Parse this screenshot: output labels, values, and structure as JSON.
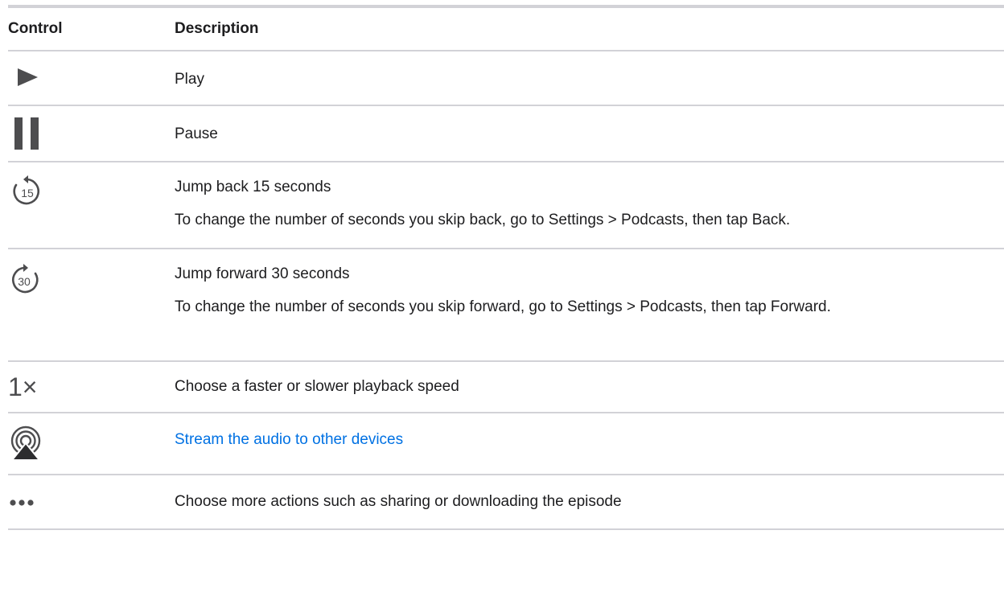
{
  "table": {
    "header": {
      "control": "Control",
      "description": "Description"
    },
    "rows": [
      {
        "icon": "play-icon",
        "lines": [
          "Play"
        ]
      },
      {
        "icon": "pause-icon",
        "lines": [
          "Pause"
        ]
      },
      {
        "icon": "skip-back-15-icon",
        "glyph": "15",
        "lines": [
          "Jump back 15 seconds",
          "To change the number of seconds you skip back, go to Settings > Podcasts, then tap Back."
        ]
      },
      {
        "icon": "skip-forward-30-icon",
        "glyph": "30",
        "lines": [
          "Jump forward 30 seconds",
          "To change the number of seconds you skip forward, go to Settings > Podcasts, then tap Forward."
        ]
      },
      {
        "icon": "playback-speed-icon",
        "glyph": "1×",
        "lines": [
          "Choose a faster or slower playback speed"
        ]
      },
      {
        "icon": "airplay-icon",
        "lines": [
          "Stream the audio to other devices"
        ],
        "link": true
      },
      {
        "icon": "more-icon",
        "lines": [
          "Choose more actions such as sharing or downloading the episode"
        ]
      }
    ]
  },
  "colors": {
    "icon": "#4d4d4f",
    "divider": "#d2d2d7",
    "link": "#0071e3"
  }
}
